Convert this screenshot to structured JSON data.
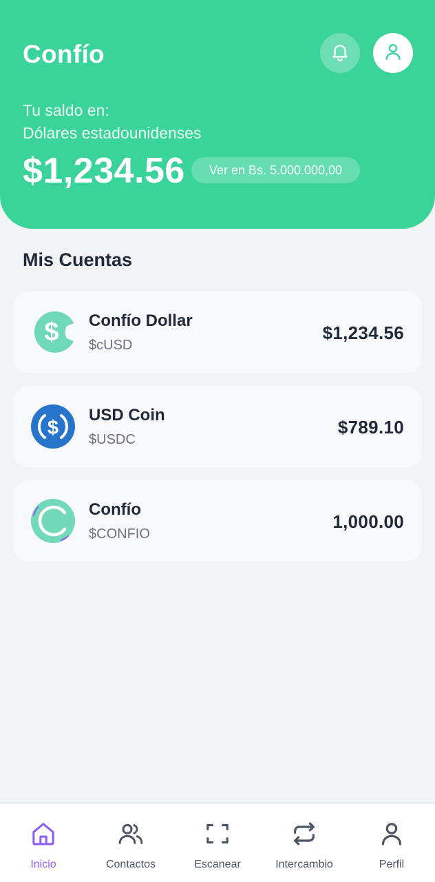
{
  "header": {
    "title": "Confío",
    "balance_label_line1": "Tu saldo en:",
    "balance_label_line2": "Dólares estadounidenses",
    "balance_amount": "$1,234.56",
    "convert_label": "Ver en Bs. 5.000.000,00",
    "icons": {
      "notifications": "bell-icon",
      "profile": "user-icon"
    }
  },
  "accounts": {
    "section_title": "Mis Cuentas",
    "items": [
      {
        "name": "Confío Dollar",
        "symbol": "$cUSD",
        "amount": "$1,234.56",
        "icon": "cusd-coin-icon"
      },
      {
        "name": "USD Coin",
        "symbol": "$USDC",
        "amount": "$789.10",
        "icon": "usdc-coin-icon"
      },
      {
        "name": "Confío",
        "symbol": "$CONFIO",
        "amount": "1,000.00",
        "icon": "confio-coin-icon"
      }
    ]
  },
  "nav": {
    "items": [
      {
        "label": "Inicio",
        "icon": "home-icon",
        "active": true
      },
      {
        "label": "Contactos",
        "icon": "users-icon",
        "active": false
      },
      {
        "label": "Escanear",
        "icon": "scan-icon",
        "active": false
      },
      {
        "label": "Intercambio",
        "icon": "exchange-icon",
        "active": false
      },
      {
        "label": "Perfil",
        "icon": "user-icon",
        "active": false
      }
    ]
  },
  "colors": {
    "brand_green": "#3AD399",
    "active_purple": "#8B5CF6",
    "usdc_blue": "#2775CA",
    "text_dark": "#1F2937",
    "text_muted": "#6B7280"
  }
}
